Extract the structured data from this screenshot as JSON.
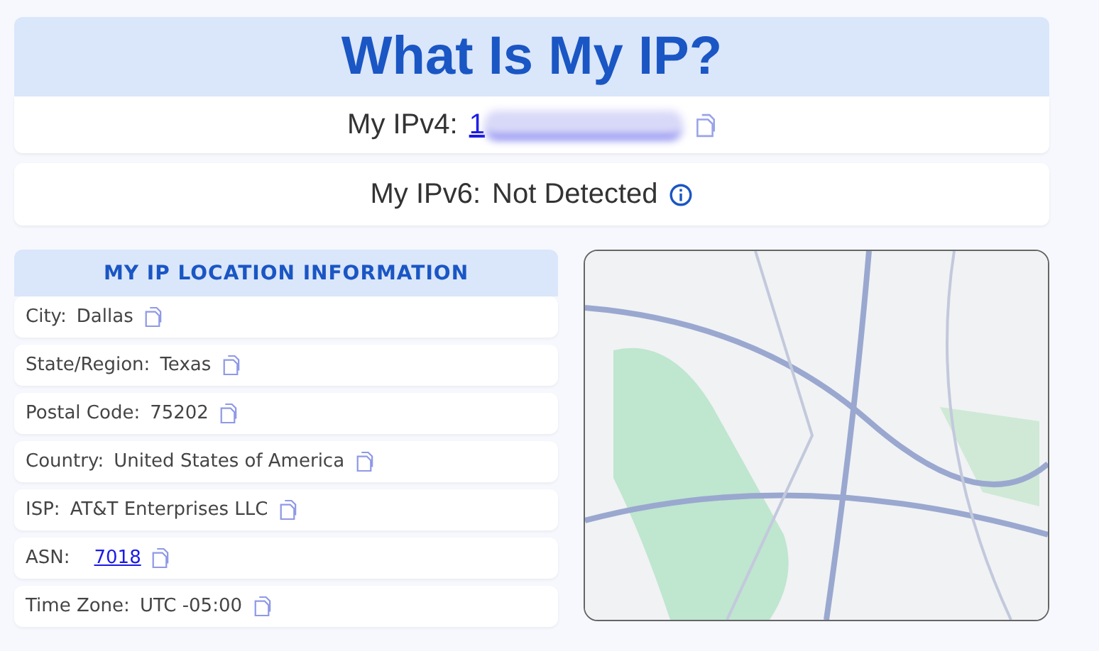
{
  "title": "What Is My IP?",
  "ipv4": {
    "label": "My IPv4:",
    "value": "1",
    "redacted": true
  },
  "ipv6": {
    "label": "My IPv6:",
    "value": "Not Detected"
  },
  "location": {
    "heading": "MY IP LOCATION INFORMATION",
    "rows": [
      {
        "label": "City:",
        "value": "Dallas",
        "kind": "text"
      },
      {
        "label": "State/Region:",
        "value": "Texas",
        "kind": "text"
      },
      {
        "label": "Postal Code:",
        "value": "75202",
        "kind": "text"
      },
      {
        "label": "Country:",
        "value": "United States of America",
        "kind": "text"
      },
      {
        "label": "ISP:",
        "value": "AT&T Enterprises LLC",
        "kind": "text"
      },
      {
        "label": "ASN:",
        "value": "7018",
        "kind": "link"
      },
      {
        "label": "Time Zone:",
        "value": "UTC -05:00",
        "kind": "text"
      }
    ]
  }
}
